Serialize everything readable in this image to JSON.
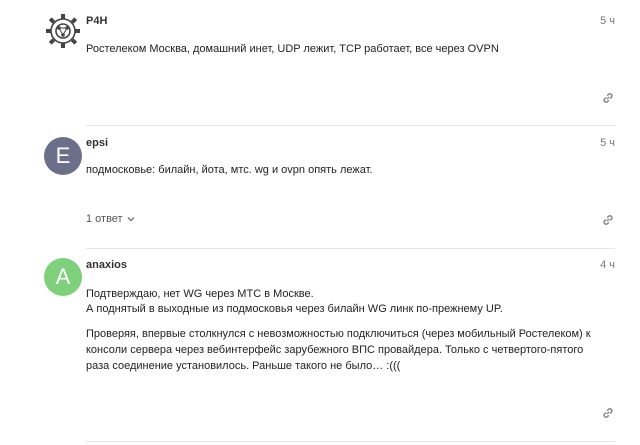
{
  "posts": [
    {
      "username": "P4H",
      "time": "5 ч",
      "avatar_icon": "gear-network-icon",
      "paragraphs": [
        "Ростелеком Москва, домашний инет, UDP лежит, TCP работает, все через OVPN"
      ]
    },
    {
      "username": "epsi",
      "time": "5 ч",
      "avatar_letter": "E",
      "avatar_color": "#6b6f8a",
      "paragraphs": [
        "подмосковье: билайн, йота, мтс. wg и ovpn опять лежат."
      ],
      "replies_label": "1 ответ"
    },
    {
      "username": "anaxios",
      "time": "4 ч",
      "avatar_letter": "A",
      "avatar_color": "#7ed07a",
      "paragraphs": [
        "Подтверждаю, нет WG через МТС в Москве.",
        "А поднятый в выходные из подмосковья через билайн WG линк по-прежнему UP.",
        "Проверяя, впервые столкнулся с невозможностью подключиться (через мобильный Ростелеком) к консоли сервера через вебинтерфейс зарубежного ВПС провайдера. Только с четвертого-пятого раза соединение установилось. Раньше такого не было… :((("
      ]
    }
  ]
}
